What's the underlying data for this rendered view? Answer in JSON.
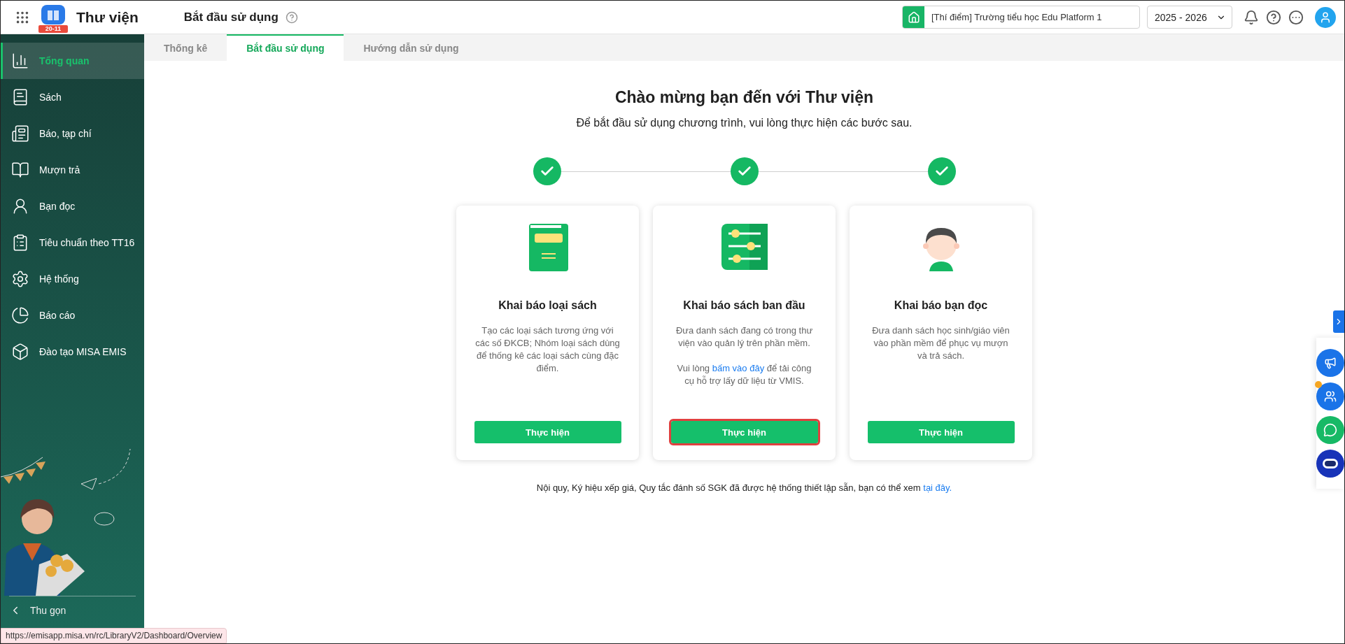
{
  "header": {
    "app_name": "Thư viện",
    "logo_badge": "20-11",
    "page_title": "Bắt đầu sử dụng",
    "school": "[Thí điểm] Trường tiểu học Edu Platform 1",
    "year": "2025 - 2026"
  },
  "sidebar": {
    "items": [
      {
        "label": "Tổng quan",
        "selected": true
      },
      {
        "label": "Sách",
        "selected": false
      },
      {
        "label": "Báo, tạp chí",
        "selected": false
      },
      {
        "label": "Mượn trả",
        "selected": false
      },
      {
        "label": "Bạn đọc",
        "selected": false
      },
      {
        "label": "Tiêu chuẩn theo TT16",
        "selected": false
      },
      {
        "label": "Hệ thống",
        "selected": false
      },
      {
        "label": "Báo cáo",
        "selected": false
      },
      {
        "label": "Đào tạo MISA EMIS",
        "selected": false
      }
    ],
    "collapse": "Thu gọn"
  },
  "tabs": [
    {
      "label": "Thống kê",
      "selected": false
    },
    {
      "label": "Bắt đầu sử dụng",
      "selected": true
    },
    {
      "label": "Hướng dẫn sử dụng",
      "selected": false
    }
  ],
  "welcome": {
    "title": "Chào mừng bạn đến với Thư viện",
    "subtitle": "Để bắt đầu sử dụng chương trình, vui lòng thực hiện các bước sau."
  },
  "steps": [
    {
      "done": true
    },
    {
      "done": true
    },
    {
      "done": true
    }
  ],
  "cards": [
    {
      "title": "Khai báo loại sách",
      "description": "Tạo các loại sách tương ứng với các số ĐKCB; Nhóm loại sách dùng để thống kê các loại sách cùng đặc điểm.",
      "button": "Thực hiện",
      "highlighted": false
    },
    {
      "title": "Khai báo sách ban đầu",
      "description": "Đưa danh sách đang có trong thư viện vào quản lý trên phần mềm.",
      "note_before": "Vui lòng",
      "note_link": "bấm vào đây",
      "note_after": "để tải công cụ hỗ trợ lấy dữ liệu từ VMIS.",
      "button": "Thực hiện",
      "highlighted": true
    },
    {
      "title": "Khai báo bạn đọc",
      "description": "Đưa danh sách học sinh/giáo viên vào phần mềm để phục vụ mượn và trả sách.",
      "button": "Thực hiện",
      "highlighted": false
    }
  ],
  "footer": {
    "text": "Nội quy, Ký hiệu xếp giá, Quy tắc đánh số SGK đã được hệ thống thiết lập sẵn, bạn có thể xem",
    "link": "tại đây."
  },
  "status_url": "https://emisapp.misa.vn/rc/LibraryV2/Dashboard/Overview"
}
